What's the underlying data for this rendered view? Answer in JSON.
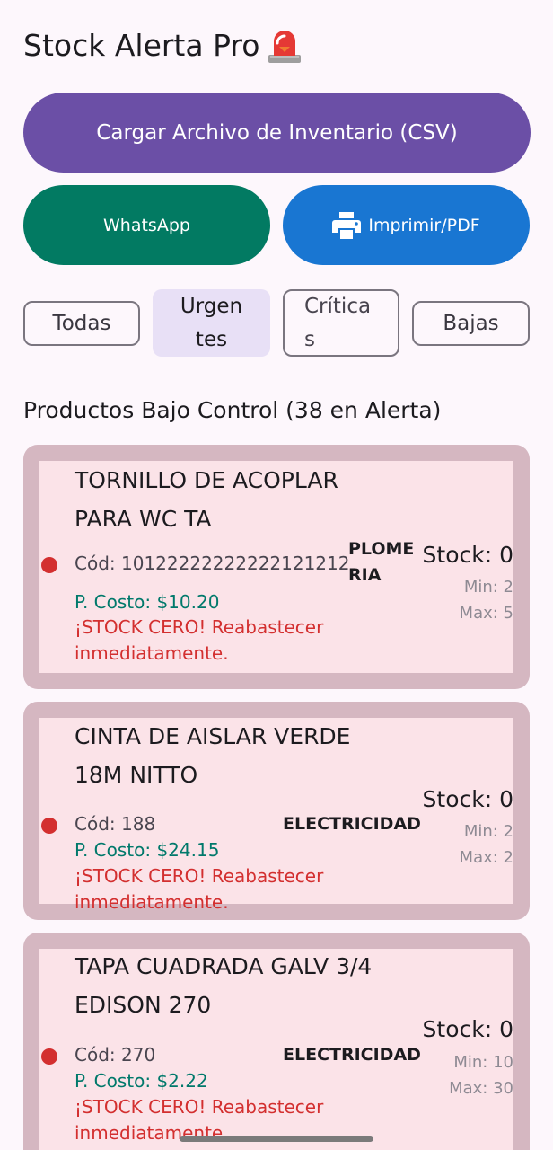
{
  "app": {
    "title": "Stock Alerta Pro",
    "title_icon": "rotating-light-icon"
  },
  "actions": {
    "load_csv_label": "Cargar Archivo de Inventario (CSV)",
    "whatsapp_label": "WhatsApp",
    "print_label": "Imprimir/PDF",
    "print_icon": "printer-icon"
  },
  "filters": {
    "selected": "Urgentes",
    "items": [
      {
        "label": "Todas"
      },
      {
        "label": "Urgentes",
        "line1": "Urgen",
        "line2": "tes"
      },
      {
        "label": "Críticas",
        "line1": "Crítica",
        "line2": "s"
      },
      {
        "label": "Bajas"
      }
    ]
  },
  "section_title": "Productos Bajo Control (38 en Alerta)",
  "colors": {
    "primary": "#6b4fa6",
    "whatsapp": "#027a62",
    "print": "#1976d2",
    "alert_red": "#d32f2f",
    "cost_teal": "#00796b",
    "card_bg": "#fbe3e8"
  },
  "products": [
    {
      "name": "TORNILLO DE ACOPLAR PARA WC TA",
      "code": "Cód: 10122222222222121212",
      "category": "PLOMERIA",
      "category_line1": "PLOME",
      "category_line2": "RIA",
      "stock": "Stock: 0",
      "min": "Min: 2",
      "max": "Max: 5",
      "cost": "P. Costo: $10.20",
      "alert": "¡STOCK CERO! Reabastecer inmediatamente."
    },
    {
      "name": "CINTA DE AISLAR VERDE 18M NITTO",
      "code": "Cód: 188",
      "category": "ELECTRICIDAD",
      "stock": "Stock: 0",
      "min": "Min: 2",
      "max": "Max: 2",
      "cost": "P. Costo: $24.15",
      "alert": "¡STOCK CERO! Reabastecer inmediatamente."
    },
    {
      "name": "TAPA CUADRADA GALV 3/4 EDISON 270",
      "code": "Cód: 270",
      "category": "ELECTRICIDAD",
      "stock": "Stock: 0",
      "min": "Min: 10",
      "max": "Max: 30",
      "cost": "P. Costo: $2.22",
      "alert": "¡STOCK CERO! Reabastecer inmediatamente."
    }
  ]
}
